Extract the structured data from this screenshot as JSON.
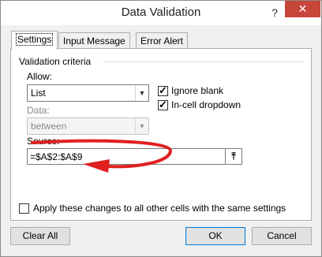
{
  "window": {
    "title": "Data Validation",
    "help_label": "?",
    "close_label": "✕"
  },
  "tabs": [
    {
      "label": "Settings",
      "active": true
    },
    {
      "label": "Input Message",
      "active": false
    },
    {
      "label": "Error Alert",
      "active": false
    }
  ],
  "settings": {
    "group_label": "Validation criteria",
    "allow": {
      "label": "Allow:",
      "value": "List"
    },
    "data": {
      "label": "Data:",
      "value": "between"
    },
    "ignore_blank": {
      "label": "Ignore blank",
      "checked": true
    },
    "incell_dropdown": {
      "label": "In-cell dropdown",
      "checked": true
    },
    "source": {
      "label": "Source:",
      "value": "=$A$2:$A$9",
      "ref_icon": "collapse-dialog-icon"
    },
    "apply_all": {
      "label": "Apply these changes to all other cells with the same settings",
      "checked": false
    }
  },
  "buttons": {
    "clear_all": "Clear All",
    "ok": "OK",
    "cancel": "Cancel"
  },
  "colors": {
    "close_bg": "#c7463a",
    "annotation_arrow": "#e02020"
  }
}
